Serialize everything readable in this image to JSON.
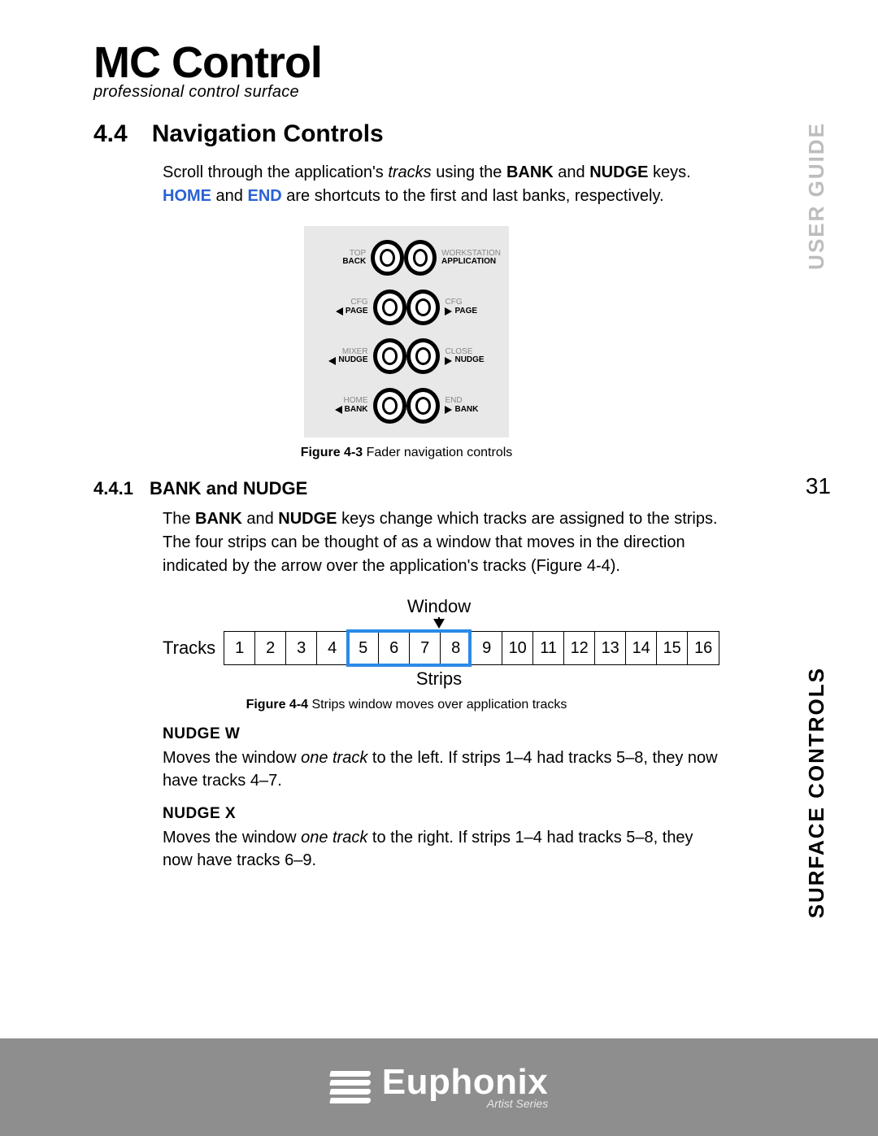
{
  "header": {
    "title": "MC Control",
    "subtitle": "professional control surface"
  },
  "side": {
    "top": "USER GUIDE",
    "bottom": "SURFACE CONTROLS",
    "pagenum": "31"
  },
  "sec": {
    "num": "4.4",
    "title": "Navigation Controls",
    "intro_a": "Scroll through the application's ",
    "intro_tracks": "tracks",
    "intro_b": " using the ",
    "intro_bank": "BANK",
    "intro_c": " and ",
    "intro_nudge": "NUDGE",
    "intro_d": " keys. ",
    "intro_home": "HOME",
    "intro_e": " and ",
    "intro_end": "END",
    "intro_f": " are shortcuts to the first and last banks, respectively."
  },
  "panel": {
    "rows": [
      {
        "l_sup": "TOP",
        "l_main": "BACK",
        "l_arrow": "",
        "r_sup": "WORKSTATION",
        "r_main": "APPLICATION",
        "r_arrow": ""
      },
      {
        "l_sup": "CFG",
        "l_main": "PAGE",
        "l_arrow": "l",
        "r_sup": "CFG",
        "r_main": "PAGE",
        "r_arrow": "r"
      },
      {
        "l_sup": "MIXER",
        "l_main": "NUDGE",
        "l_arrow": "l",
        "r_sup": "CLOSE",
        "r_main": "NUDGE",
        "r_arrow": "r"
      },
      {
        "l_sup": "HOME",
        "l_main": "BANK",
        "l_arrow": "l",
        "r_sup": "END",
        "r_main": "BANK",
        "r_arrow": "r"
      }
    ],
    "caption_b": "Figure 4-3",
    "caption_t": " Fader navigation controls"
  },
  "sub": {
    "num": "4.4.1",
    "title": "BANK and NUDGE",
    "p_a": "The ",
    "p_bank": "BANK",
    "p_b": " and ",
    "p_nudge": "NUDGE",
    "p_c": " keys change which tracks are assigned to the strips. The four strips can be thought of as a window that moves in the direction indicated by the arrow over the application's tracks (Figure 4-4)."
  },
  "tracks": {
    "top": "Window",
    "label": "Tracks",
    "cells": [
      "1",
      "2",
      "3",
      "4",
      "5",
      "6",
      "7",
      "8",
      "9",
      "10",
      "11",
      "12",
      "13",
      "14",
      "15",
      "16"
    ],
    "window_start_index": 4,
    "window_len": 4,
    "bottom": "Strips",
    "caption_b": "Figure 4-4",
    "caption_t": " Strips window moves over application tracks"
  },
  "nudge_left": {
    "h_a": "NUDGE ",
    "h_sym": "W",
    "p_a": "Moves the window ",
    "p_i": "one track",
    "p_b": " to the left. If strips 1–4 had tracks 5–8, they now have tracks 4–7."
  },
  "nudge_right": {
    "h_a": "NUDGE ",
    "h_sym": "X",
    "p_a": "Moves the window ",
    "p_i": "one track",
    "p_b": " to the right. If strips 1–4 had tracks 5–8, they now have tracks 6–9."
  },
  "footer": {
    "brand": "Euphonix",
    "series": "Artist Series"
  }
}
